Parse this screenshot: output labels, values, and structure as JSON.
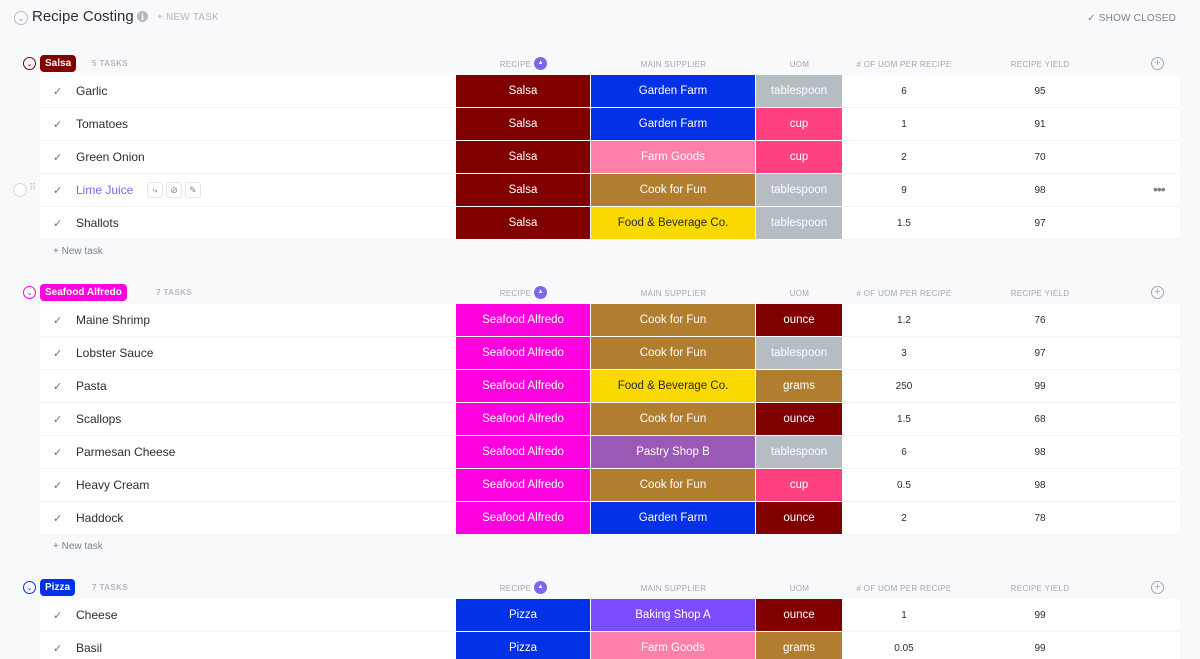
{
  "header": {
    "title": "Recipe Costing",
    "new_task_label": "+ NEW TASK",
    "show_closed_label": "✓ SHOW CLOSED"
  },
  "columns": {
    "recipe": "RECIPE",
    "main_supplier": "MAIN SUPPLIER",
    "uom": "UOM",
    "uom_per_recipe": "# OF UOM PER RECIPE",
    "recipe_yield": "RECIPE YIELD"
  },
  "new_task_row_label": "+ New task",
  "colors": {
    "Salsa": "#800000",
    "Seafood Alfredo": "#ff00df",
    "Pizza": "#0231e8",
    "Garden Farm": "#0231e8",
    "Farm Goods": "#ff7fab",
    "Cook for Fun": "#b17e2f",
    "Food & Beverage Co.": "#f9d900",
    "Pastry Shop B": "#9b59b6",
    "Baking Shop A": "#7c4dff",
    "tablespoon": "#b5bcc2",
    "cup": "#ff4081",
    "ounce": "#800000",
    "grams": "#b17e2f"
  },
  "groups": [
    {
      "name": "Salsa",
      "color": "#800000",
      "count_label": "5 TASKS",
      "tasks": [
        {
          "name": "Garlic",
          "recipe": "Salsa",
          "supplier": "Garden Farm",
          "uom": "tablespoon",
          "uom_per_recipe": "6",
          "yield": "95"
        },
        {
          "name": "Tomatoes",
          "recipe": "Salsa",
          "supplier": "Garden Farm",
          "uom": "cup",
          "uom_per_recipe": "1",
          "yield": "91"
        },
        {
          "name": "Green Onion",
          "recipe": "Salsa",
          "supplier": "Farm Goods",
          "uom": "cup",
          "uom_per_recipe": "2",
          "yield": "70"
        },
        {
          "name": "Lime Juice",
          "recipe": "Salsa",
          "supplier": "Cook for Fun",
          "uom": "tablespoon",
          "uom_per_recipe": "9",
          "yield": "98",
          "hover": true
        },
        {
          "name": "Shallots",
          "recipe": "Salsa",
          "supplier": "Food & Beverage Co.",
          "uom": "tablespoon",
          "uom_per_recipe": "1.5",
          "yield": "97"
        }
      ]
    },
    {
      "name": "Seafood Alfredo",
      "color": "#ff00df",
      "count_label": "7 TASKS",
      "tasks": [
        {
          "name": "Maine Shrimp",
          "recipe": "Seafood Alfredo",
          "supplier": "Cook for Fun",
          "uom": "ounce",
          "uom_per_recipe": "1.2",
          "yield": "76"
        },
        {
          "name": "Lobster Sauce",
          "recipe": "Seafood Alfredo",
          "supplier": "Cook for Fun",
          "uom": "tablespoon",
          "uom_per_recipe": "3",
          "yield": "97"
        },
        {
          "name": "Pasta",
          "recipe": "Seafood Alfredo",
          "supplier": "Food & Beverage Co.",
          "uom": "grams",
          "uom_per_recipe": "250",
          "yield": "99"
        },
        {
          "name": "Scallops",
          "recipe": "Seafood Alfredo",
          "supplier": "Cook for Fun",
          "uom": "ounce",
          "uom_per_recipe": "1.5",
          "yield": "68"
        },
        {
          "name": "Parmesan Cheese",
          "recipe": "Seafood Alfredo",
          "supplier": "Pastry Shop B",
          "uom": "tablespoon",
          "uom_per_recipe": "6",
          "yield": "98"
        },
        {
          "name": "Heavy Cream",
          "recipe": "Seafood Alfredo",
          "supplier": "Cook for Fun",
          "uom": "cup",
          "uom_per_recipe": "0.5",
          "yield": "98"
        },
        {
          "name": "Haddock",
          "recipe": "Seafood Alfredo",
          "supplier": "Garden Farm",
          "uom": "ounce",
          "uom_per_recipe": "2",
          "yield": "78"
        }
      ]
    },
    {
      "name": "Pizza",
      "color": "#0231e8",
      "count_label": "7 TASKS",
      "tasks": [
        {
          "name": "Cheese",
          "recipe": "Pizza",
          "supplier": "Baking Shop A",
          "uom": "ounce",
          "uom_per_recipe": "1",
          "yield": "99"
        },
        {
          "name": "Basil",
          "recipe": "Pizza",
          "supplier": "Farm Goods",
          "uom": "grams",
          "uom_per_recipe": "0.05",
          "yield": "99"
        }
      ]
    }
  ]
}
